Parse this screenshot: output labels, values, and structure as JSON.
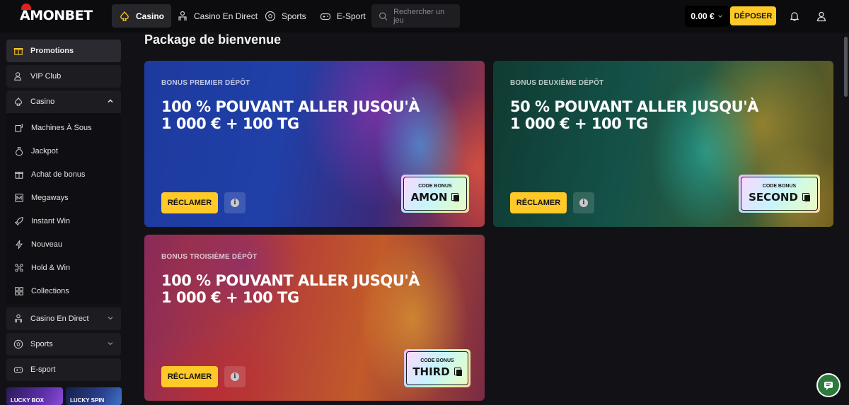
{
  "brand": {
    "logo": "AMONBET"
  },
  "topnav": {
    "items": [
      {
        "label": "Casino",
        "icon": "spade-icon"
      },
      {
        "label": "Casino En Direct",
        "icon": "dealer-icon"
      },
      {
        "label": "Sports",
        "icon": "soccer-ball-icon"
      },
      {
        "label": "E-Sport",
        "icon": "gamepad-icon"
      }
    ],
    "search_placeholder": "Rechercher un jeu",
    "balance": "0.00 €",
    "deposit_label": "DÉPOSER"
  },
  "sidebar": {
    "items": [
      {
        "label": "Promotions",
        "icon": "gift-icon"
      },
      {
        "label": "VIP Club",
        "icon": "user-vip-icon"
      },
      {
        "label": "Casino",
        "icon": "spade-icon"
      }
    ],
    "casino_sub": [
      {
        "label": "Machines À Sous",
        "icon": "slot-machine-icon"
      },
      {
        "label": "Jackpot",
        "icon": "money-bag-icon"
      },
      {
        "label": "Achat de bonus",
        "icon": "gift-box-icon"
      },
      {
        "label": "Megaways",
        "icon": "megaways-icon"
      },
      {
        "label": "Instant Win",
        "icon": "rocket-icon"
      },
      {
        "label": "Nouveau",
        "icon": "lightning-icon"
      },
      {
        "label": "Hold & Win",
        "icon": "hold-win-icon"
      },
      {
        "label": "Collections",
        "icon": "grid-icon"
      }
    ],
    "bottom_items": [
      {
        "label": "Casino En Direct",
        "icon": "dealer-icon"
      },
      {
        "label": "Sports",
        "icon": "soccer-ball-icon"
      },
      {
        "label": "E-sport",
        "icon": "gamepad-icon"
      }
    ],
    "promos": [
      "LUCKY BOX",
      "LUCKY SPIN"
    ]
  },
  "main": {
    "title": "Package de bienvenue",
    "cards": [
      {
        "label": "BONUS PREMIER DÉPÔT",
        "headline_1": "100 % POUVANT ALLER JUSQU'À",
        "headline_2": "1 000 € + 100 TG",
        "claim": "RÉCLAMER",
        "code_title": "CODE BONUS",
        "code": "AMON"
      },
      {
        "label": "BONUS DEUXIÈME DÉPÔT",
        "headline_1": "50 % POUVANT ALLER JUSQU'À",
        "headline_2": "1 000 € + 100 TG",
        "claim": "RÉCLAMER",
        "code_title": "CODE BONUS",
        "code": "SECOND"
      },
      {
        "label": "BONUS TROISIÈME DÉPÔT",
        "headline_1": "100 % POUVANT ALLER JUSQU'À",
        "headline_2": "1 000 € + 100 TG",
        "claim": "RÉCLAMER",
        "code_title": "CODE BONUS",
        "code": "THIRD"
      }
    ]
  },
  "colors": {
    "accent": "#ffc928",
    "background": "#121216",
    "topbar": "#0c0c0f"
  }
}
